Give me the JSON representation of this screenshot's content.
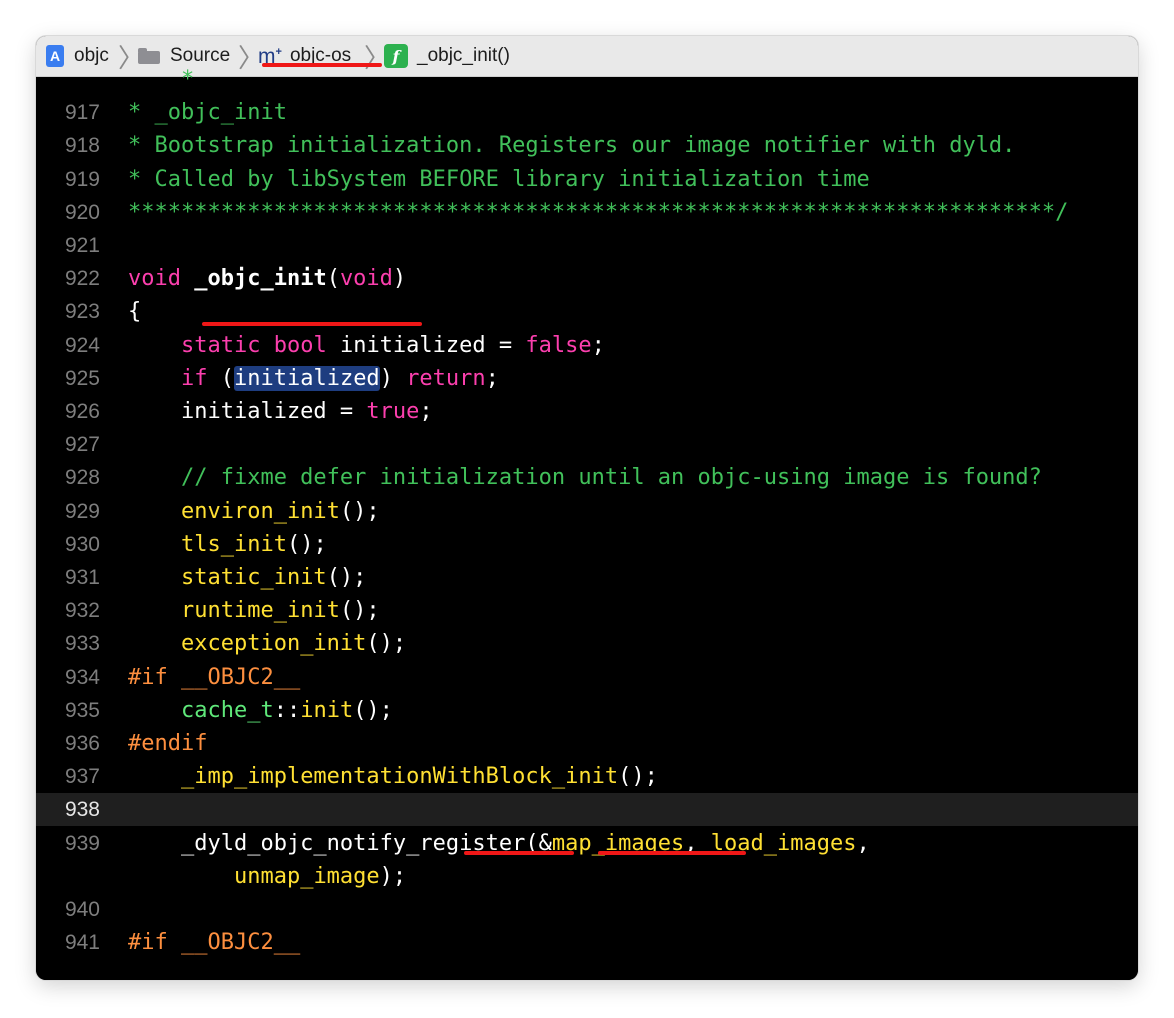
{
  "breadcrumb": {
    "project": "objc",
    "folder": "Source",
    "file": "objc-os",
    "symbol": "_objc_init()",
    "project_icon": "A",
    "file_icon": "m",
    "file_icon_sup": "+",
    "function_icon": "f"
  },
  "colors": {
    "background": "#000000",
    "comment": "#41c05a",
    "keyword": "#fc3fae",
    "function": "#ffe033",
    "preprocessor": "#fd8f3f",
    "type": "#5fe87a",
    "selection": "#1e3d80",
    "annotation": "#ef1717"
  },
  "code_lines": [
    {
      "num": "",
      "tokens": [
        {
          "t": "    *",
          "c": "comment"
        }
      ]
    },
    {
      "num": "917",
      "tokens": [
        {
          "t": "* _objc_init",
          "c": "comment"
        }
      ]
    },
    {
      "num": "918",
      "tokens": [
        {
          "t": "* Bootstrap initialization. Registers our image notifier with dyld.",
          "c": "comment"
        }
      ]
    },
    {
      "num": "919",
      "tokens": [
        {
          "t": "* Called by libSystem BEFORE library initialization time",
          "c": "comment"
        }
      ]
    },
    {
      "num": "920",
      "tokens": [
        {
          "t": "**********************************************************************/",
          "c": "comment"
        }
      ]
    },
    {
      "num": "921",
      "tokens": []
    },
    {
      "num": "922",
      "tokens": [
        {
          "t": "void",
          "c": "kw"
        },
        {
          "t": " ",
          "c": "plain"
        },
        {
          "t": "_objc_init",
          "c": "bold"
        },
        {
          "t": "(",
          "c": "plain"
        },
        {
          "t": "void",
          "c": "kw"
        },
        {
          "t": ")",
          "c": "plain"
        }
      ]
    },
    {
      "num": "923",
      "tokens": [
        {
          "t": "{",
          "c": "plain"
        }
      ]
    },
    {
      "num": "924",
      "tokens": [
        {
          "t": "    ",
          "c": "plain"
        },
        {
          "t": "static",
          "c": "kw"
        },
        {
          "t": " ",
          "c": "plain"
        },
        {
          "t": "bool",
          "c": "kw"
        },
        {
          "t": " initialized = ",
          "c": "plain"
        },
        {
          "t": "false",
          "c": "kw"
        },
        {
          "t": ";",
          "c": "plain"
        }
      ]
    },
    {
      "num": "925",
      "tokens": [
        {
          "t": "    ",
          "c": "plain"
        },
        {
          "t": "if",
          "c": "kw"
        },
        {
          "t": " (",
          "c": "plain"
        },
        {
          "t": "initialized",
          "c": "sel"
        },
        {
          "t": ") ",
          "c": "plain"
        },
        {
          "t": "return",
          "c": "kw"
        },
        {
          "t": ";",
          "c": "plain"
        }
      ]
    },
    {
      "num": "926",
      "tokens": [
        {
          "t": "    initialized = ",
          "c": "plain"
        },
        {
          "t": "true",
          "c": "kw"
        },
        {
          "t": ";",
          "c": "plain"
        }
      ]
    },
    {
      "num": "927",
      "tokens": []
    },
    {
      "num": "928",
      "tokens": [
        {
          "t": "    // fixme defer initialization until an objc-using image is found?",
          "c": "comment"
        }
      ]
    },
    {
      "num": "929",
      "tokens": [
        {
          "t": "    ",
          "c": "plain"
        },
        {
          "t": "environ_init",
          "c": "fn"
        },
        {
          "t": "();",
          "c": "plain"
        }
      ]
    },
    {
      "num": "930",
      "tokens": [
        {
          "t": "    ",
          "c": "plain"
        },
        {
          "t": "tls_init",
          "c": "fn"
        },
        {
          "t": "();",
          "c": "plain"
        }
      ]
    },
    {
      "num": "931",
      "tokens": [
        {
          "t": "    ",
          "c": "plain"
        },
        {
          "t": "static_init",
          "c": "fn"
        },
        {
          "t": "();",
          "c": "plain"
        }
      ]
    },
    {
      "num": "932",
      "tokens": [
        {
          "t": "    ",
          "c": "plain"
        },
        {
          "t": "runtime_init",
          "c": "fn"
        },
        {
          "t": "();",
          "c": "plain"
        }
      ]
    },
    {
      "num": "933",
      "tokens": [
        {
          "t": "    ",
          "c": "plain"
        },
        {
          "t": "exception_init",
          "c": "fn"
        },
        {
          "t": "();",
          "c": "plain"
        }
      ]
    },
    {
      "num": "934",
      "tokens": [
        {
          "t": "#if __OBJC2__",
          "c": "pp"
        }
      ]
    },
    {
      "num": "935",
      "tokens": [
        {
          "t": "    ",
          "c": "plain"
        },
        {
          "t": "cache_t",
          "c": "type"
        },
        {
          "t": "::",
          "c": "plain"
        },
        {
          "t": "init",
          "c": "fn"
        },
        {
          "t": "();",
          "c": "plain"
        }
      ]
    },
    {
      "num": "936",
      "tokens": [
        {
          "t": "#endif",
          "c": "pp"
        }
      ]
    },
    {
      "num": "937",
      "tokens": [
        {
          "t": "    ",
          "c": "plain"
        },
        {
          "t": "_imp_implementationWithBlock_init",
          "c": "fn"
        },
        {
          "t": "();",
          "c": "plain"
        }
      ]
    },
    {
      "num": "938",
      "tokens": [],
      "current": true
    },
    {
      "num": "939",
      "tokens": [
        {
          "t": "    _dyld_objc_notify_register(&",
          "c": "plain"
        },
        {
          "t": "map_images",
          "c": "fn"
        },
        {
          "t": ", ",
          "c": "plain"
        },
        {
          "t": "load_images",
          "c": "fn"
        },
        {
          "t": ",",
          "c": "plain"
        }
      ]
    },
    {
      "num": "",
      "tokens": [
        {
          "t": "        ",
          "c": "plain"
        },
        {
          "t": "unmap_image",
          "c": "fn"
        },
        {
          "t": ");",
          "c": "plain"
        }
      ]
    },
    {
      "num": "940",
      "tokens": []
    },
    {
      "num": "941",
      "tokens": [
        {
          "t": "#if __OBJC2__",
          "c": "pp"
        }
      ]
    }
  ]
}
